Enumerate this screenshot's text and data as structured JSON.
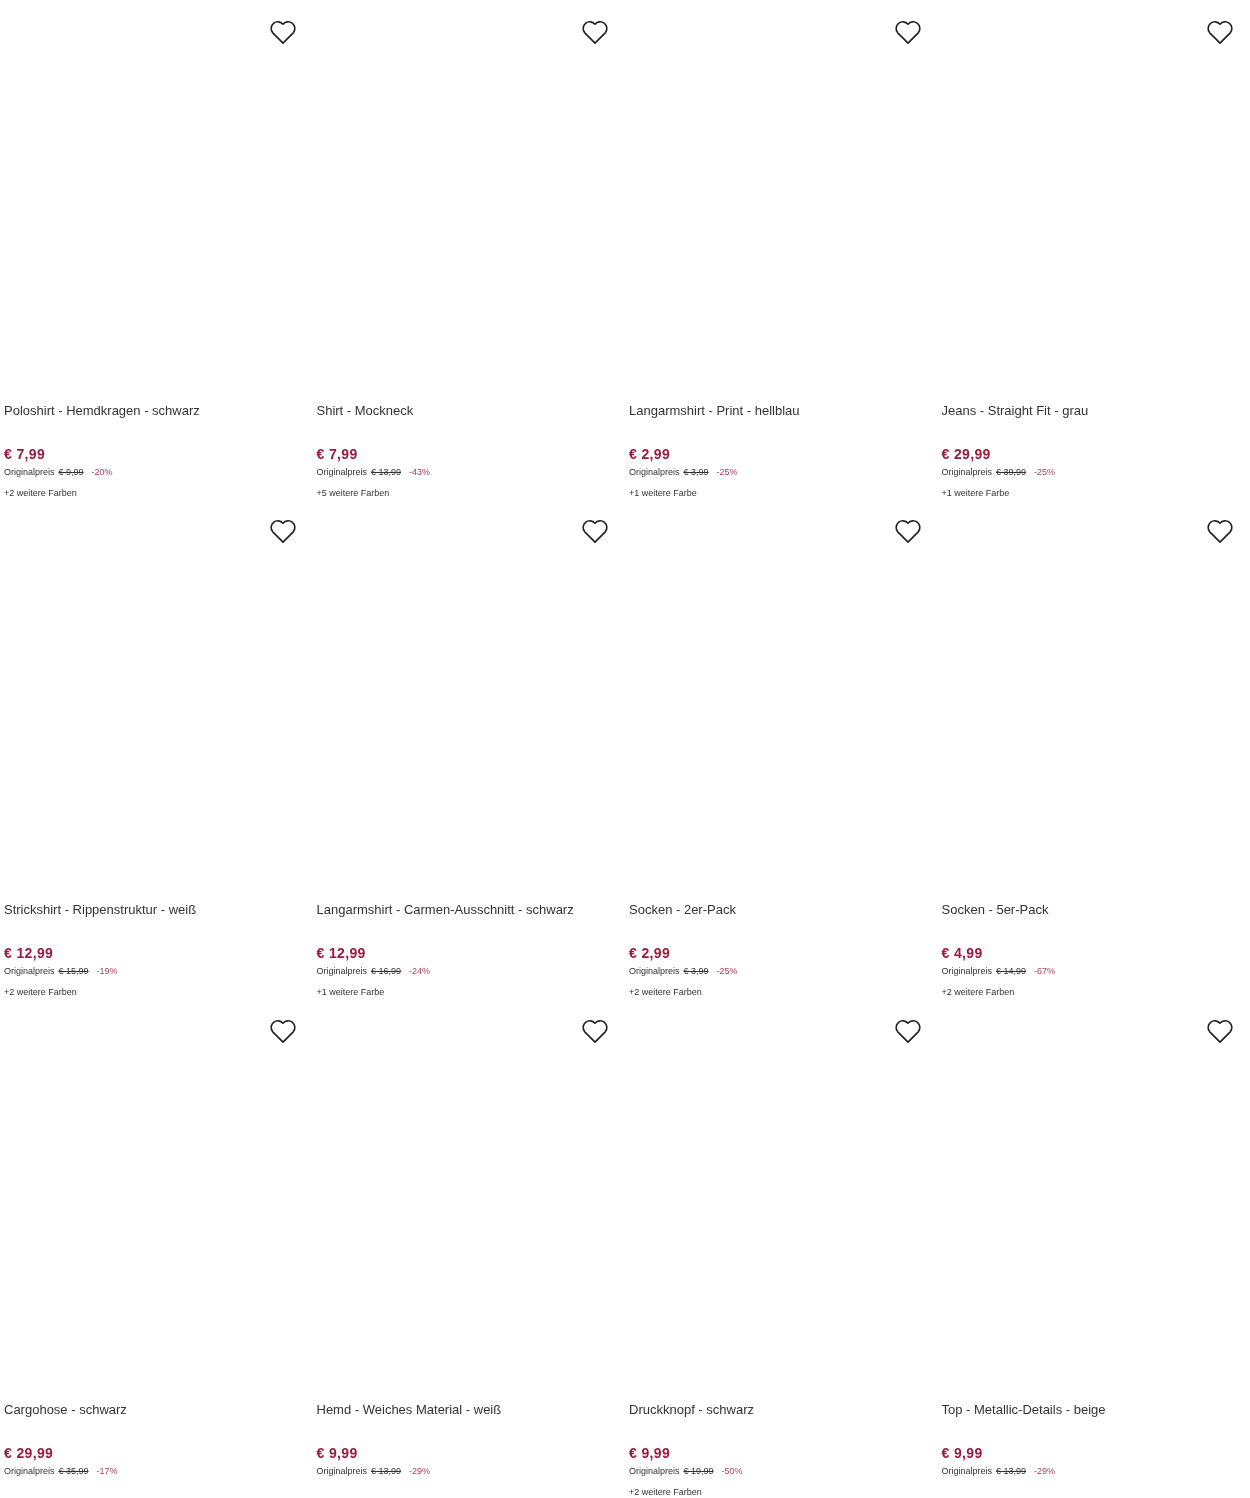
{
  "products": [
    {
      "title": "Poloshirt - Hemdkragen - schwarz",
      "price": "€ 7,99",
      "original_label": "Originalpreis",
      "original_price": "€ 9,99",
      "discount": "-20%",
      "more_colors": "+2 weitere Farben"
    },
    {
      "title": "Shirt - Mockneck",
      "price": "€ 7,99",
      "original_label": "Originalpreis",
      "original_price": "€ 13,99",
      "discount": "-43%",
      "more_colors": "+5 weitere Farben"
    },
    {
      "title": "Langarmshirt - Print - hellblau",
      "price": "€ 2,99",
      "original_label": "Originalpreis",
      "original_price": "€ 3,99",
      "discount": "-25%",
      "more_colors": "+1 weitere Farbe"
    },
    {
      "title": "Jeans - Straight Fit - grau",
      "price": "€ 29,99",
      "original_label": "Originalpreis",
      "original_price": "€ 39,99",
      "discount": "-25%",
      "more_colors": "+1 weitere Farbe"
    },
    {
      "title": "Strickshirt - Rippenstruktur - weiß",
      "price": "€ 12,99",
      "original_label": "Originalpreis",
      "original_price": "€ 15,99",
      "discount": "-19%",
      "more_colors": "+2 weitere Farben"
    },
    {
      "title": "Langarmshirt - Carmen-Ausschnitt - schwarz",
      "price": "€ 12,99",
      "original_label": "Originalpreis",
      "original_price": "€ 16,99",
      "discount": "-24%",
      "more_colors": "+1 weitere Farbe"
    },
    {
      "title": "Socken - 2er-Pack",
      "price": "€ 2,99",
      "original_label": "Originalpreis",
      "original_price": "€ 3,99",
      "discount": "-25%",
      "more_colors": "+2 weitere Farben"
    },
    {
      "title": "Socken - 5er-Pack",
      "price": "€ 4,99",
      "original_label": "Originalpreis",
      "original_price": "€ 14,99",
      "discount": "-67%",
      "more_colors": "+2 weitere Farben"
    },
    {
      "title": "Cargohose - schwarz",
      "price": "€ 29,99",
      "original_label": "Originalpreis",
      "original_price": "€ 35,99",
      "discount": "-17%"
    },
    {
      "title": "Hemd - Weiches Material - weiß",
      "price": "€ 9,99",
      "original_label": "Originalpreis",
      "original_price": "€ 13,99",
      "discount": "-29%"
    },
    {
      "title": "Druckknopf - schwarz",
      "price": "€ 9,99",
      "original_label": "Originalpreis",
      "original_price": "€ 19,99",
      "discount": "-50%",
      "more_colors": "+2 weitere Farben"
    },
    {
      "title": "Top - Metallic-Details - beige",
      "price": "€ 9,99",
      "original_label": "Originalpreis",
      "original_price": "€ 13,99",
      "discount": "-29%"
    }
  ]
}
